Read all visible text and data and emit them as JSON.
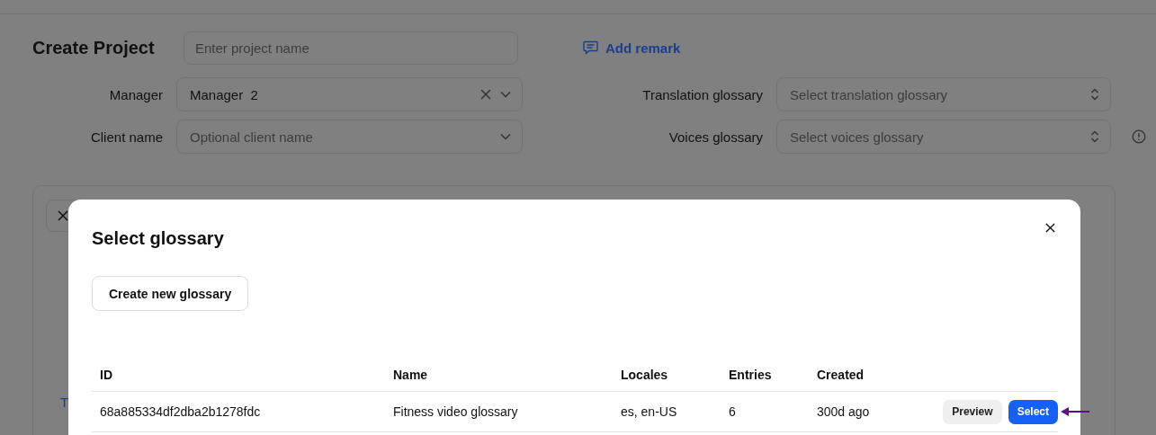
{
  "form": {
    "title": "Create Project",
    "project_name": {
      "placeholder": "Enter project name"
    },
    "remark_link": "Add remark",
    "left_fields": [
      {
        "label": "Manager",
        "value": "Manager  2",
        "clearable": true,
        "kind": "dropdown"
      },
      {
        "label": "Client name",
        "placeholder": "Optional client name",
        "clearable": false,
        "kind": "dropdown"
      }
    ],
    "right_fields": [
      {
        "label": "Translation glossary",
        "placeholder": "Select translation glossary",
        "kind": "updown",
        "info": false
      },
      {
        "label": "Voices glossary",
        "placeholder": "Select voices glossary",
        "kind": "updown",
        "info": true
      }
    ],
    "card_label": "T"
  },
  "dialog": {
    "title": "Select glossary",
    "create_button": "Create new glossary",
    "columns": [
      "ID",
      "Name",
      "Locales",
      "Entries",
      "Created"
    ],
    "rows": [
      {
        "cells": [
          "68a885334df2dba2b1278fdc",
          "Fitness video glossary",
          "es, en-US",
          "6",
          "300d ago"
        ],
        "actions": [
          "Preview",
          "Select"
        ],
        "pointed": true
      }
    ]
  }
}
